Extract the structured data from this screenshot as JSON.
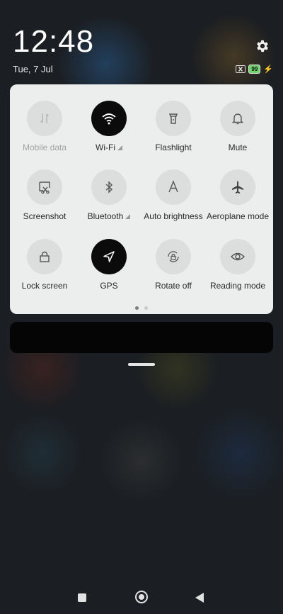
{
  "status": {
    "time": "12:48",
    "date": "Tue, 7 Jul",
    "battery_level": "99"
  },
  "icons": {
    "settings": "gear-icon",
    "sim": "sim-disabled-icon",
    "charging": "charging-bolt-icon"
  },
  "quick_settings": {
    "tiles": [
      {
        "label": "Mobile data",
        "icon": "mobile-data-icon",
        "active": false,
        "enabled": false
      },
      {
        "label": "Wi-Fi",
        "icon": "wifi-icon",
        "active": true,
        "enabled": true
      },
      {
        "label": "Flashlight",
        "icon": "flashlight-icon",
        "active": false,
        "enabled": true
      },
      {
        "label": "Mute",
        "icon": "bell-icon",
        "active": false,
        "enabled": true
      },
      {
        "label": "Screenshot",
        "icon": "screenshot-icon",
        "active": false,
        "enabled": true
      },
      {
        "label": "Bluetooth",
        "icon": "bluetooth-icon",
        "active": false,
        "enabled": true
      },
      {
        "label": "Auto brightness",
        "icon": "auto-brightness-icon",
        "active": false,
        "enabled": true
      },
      {
        "label": "Aeroplane mode",
        "icon": "airplane-icon",
        "active": false,
        "enabled": true
      },
      {
        "label": "Lock screen",
        "icon": "lock-icon",
        "active": false,
        "enabled": true
      },
      {
        "label": "GPS",
        "icon": "location-arrow-icon",
        "active": true,
        "enabled": true
      },
      {
        "label": "Rotate off",
        "icon": "rotate-lock-icon",
        "active": false,
        "enabled": true
      },
      {
        "label": "Reading mode",
        "icon": "eye-icon",
        "active": false,
        "enabled": true
      }
    ],
    "pages": 2,
    "current_page": 1
  },
  "colors": {
    "panel_bg": "#eceded",
    "tile_off": "#dcdddd",
    "tile_on": "#0b0b0b",
    "battery": "#6ed36b"
  },
  "navbar": {
    "recents": "square-icon",
    "home": "circle-icon",
    "back": "triangle-back-icon"
  }
}
